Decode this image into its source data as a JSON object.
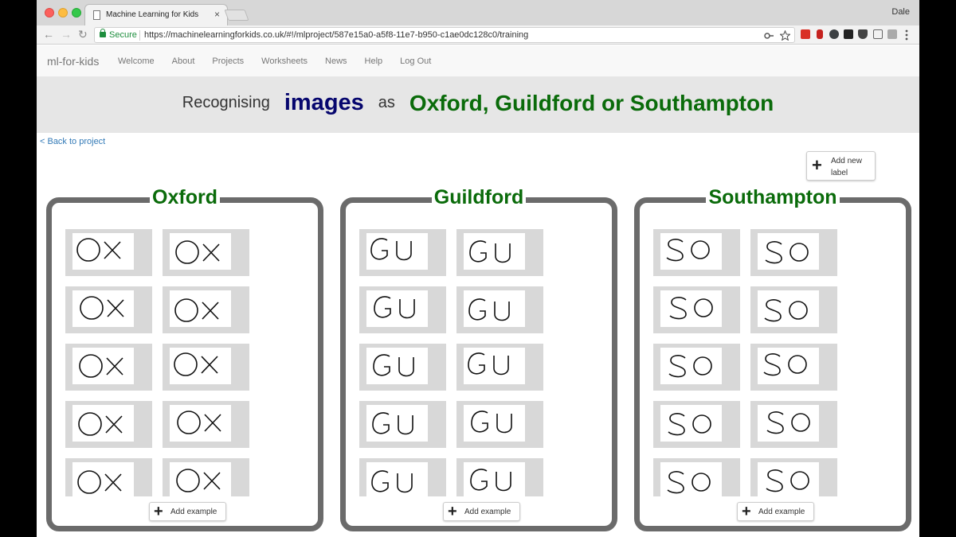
{
  "browser": {
    "tab_title": "Machine Learning for Kids",
    "tab_close": "×",
    "user": "Dale",
    "secure_label": "Secure",
    "url": "https://machinelearningforkids.co.uk/#!/mlproject/587e15a0-a5f8-11e7-b950-c1ae0dc128c0/training",
    "back_glyph": "←",
    "forward_glyph": "→",
    "reload_glyph": "↻"
  },
  "nav": {
    "brand": "ml-for-kids",
    "links": [
      "Welcome",
      "About",
      "Projects",
      "Worksheets",
      "News",
      "Help",
      "Log Out"
    ]
  },
  "heading": {
    "prefix": "Recognising",
    "type": "images",
    "middle": "as",
    "labels_text": "Oxford, Guildford or Southampton"
  },
  "back_link": "< Back to project",
  "add_label": {
    "icon": "+",
    "text": "Add new label"
  },
  "labels": [
    {
      "name": "Oxford",
      "sketch": "OX",
      "examples_visible": 10,
      "add_example": "Add example",
      "add_icon": "+"
    },
    {
      "name": "Guildford",
      "sketch": "GU",
      "examples_visible": 10,
      "add_example": "Add example",
      "add_icon": "+"
    },
    {
      "name": "Southampton",
      "sketch": "SO",
      "examples_visible": 10,
      "add_example": "Add example",
      "add_icon": "+"
    }
  ],
  "colors": {
    "label_green": "#0a6b0a",
    "type_navy": "#06066e",
    "panel_border": "#6b6b6b",
    "link_blue": "#337ab7"
  }
}
